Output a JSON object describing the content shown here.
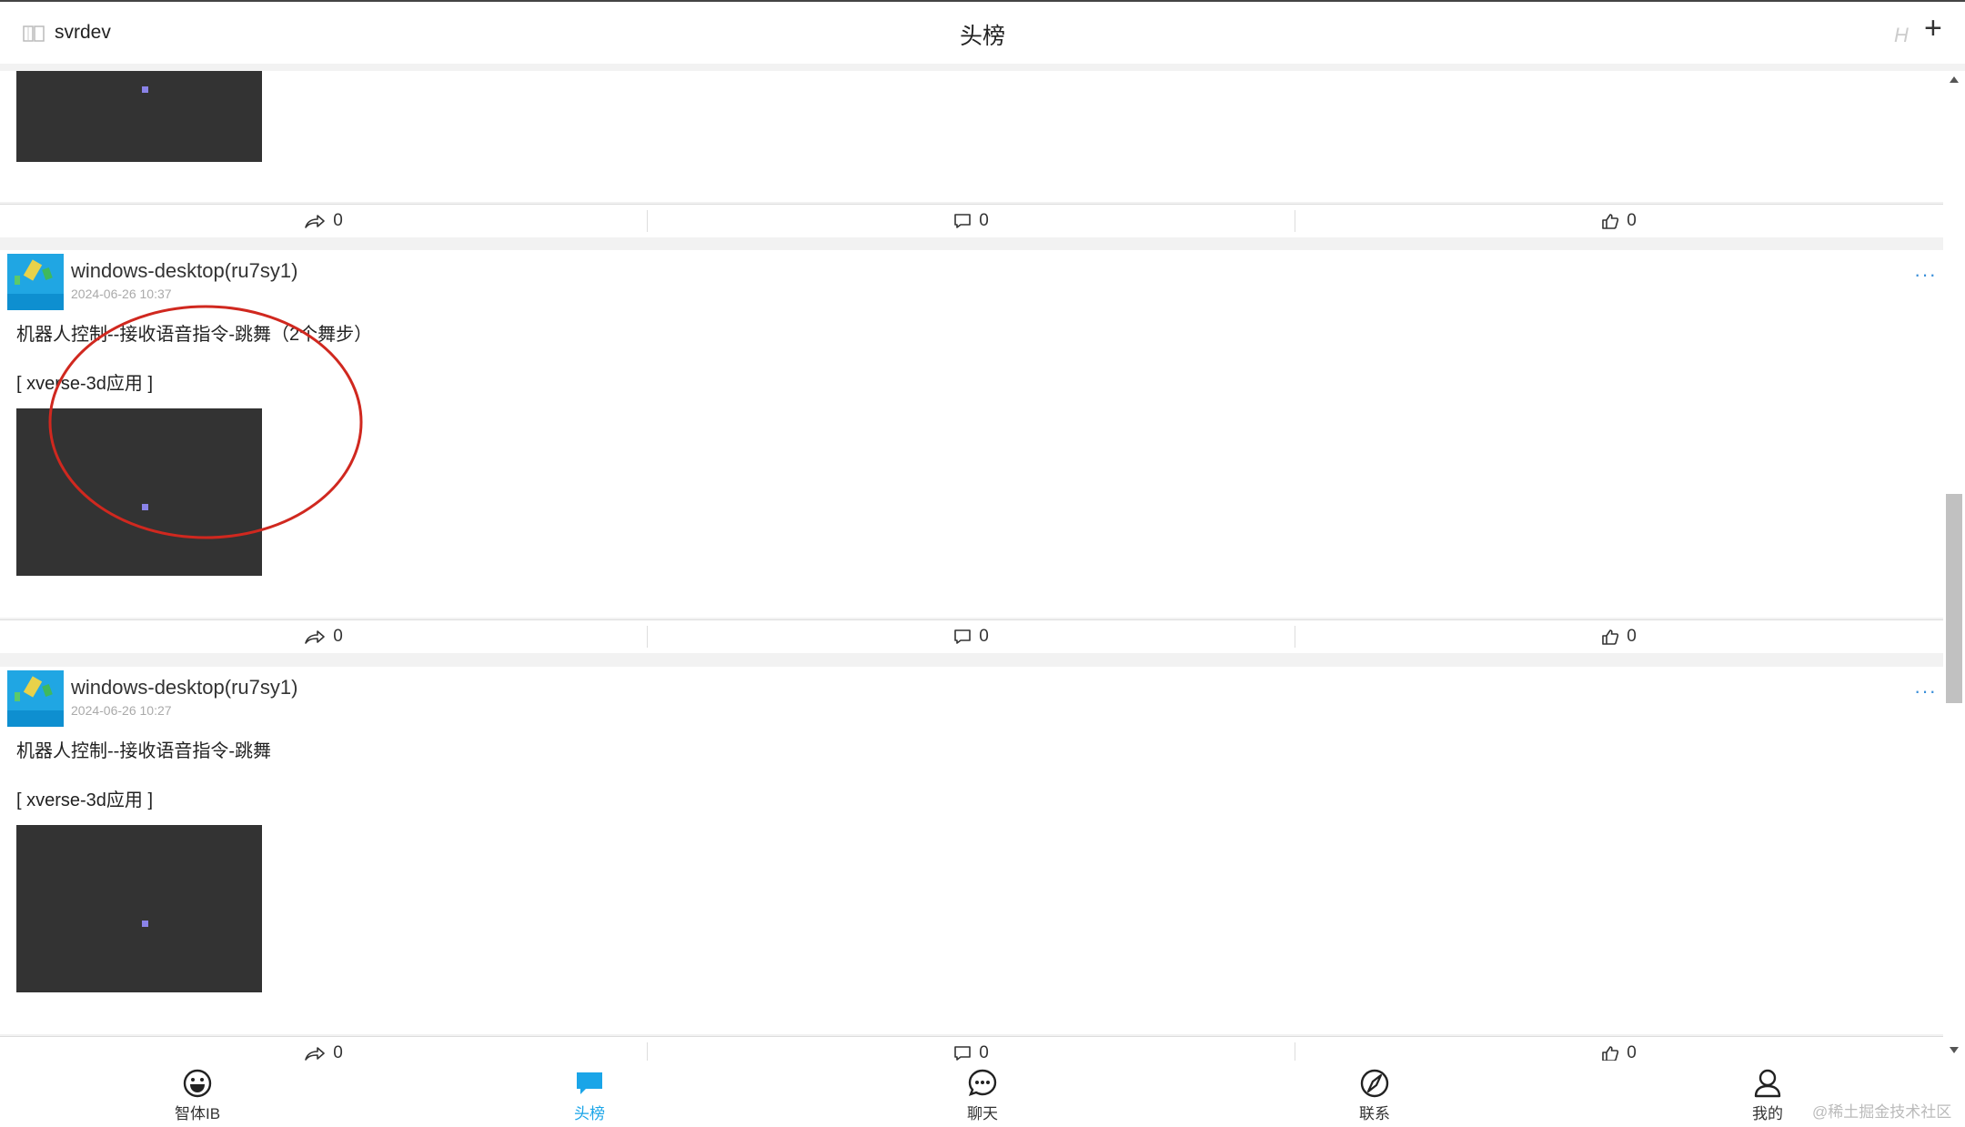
{
  "header": {
    "app_name": "svrdev",
    "title": "头榜",
    "h_label": "H",
    "plus_label": "+"
  },
  "posts": [
    {
      "actions": {
        "share_count": "0",
        "comment_count": "0",
        "like_count": "0"
      }
    },
    {
      "author": "windows-desktop(ru7sy1)",
      "time": "2024-06-26 10:37",
      "text": "机器人控制--接收语音指令-跳舞（2个舞步）",
      "tag": "[ xverse-3d应用 ]",
      "actions": {
        "share_count": "0",
        "comment_count": "0",
        "like_count": "0"
      }
    },
    {
      "author": "windows-desktop(ru7sy1)",
      "time": "2024-06-26 10:27",
      "text": "机器人控制--接收语音指令-跳舞",
      "tag": "[ xverse-3d应用 ]",
      "actions": {
        "share_count": "0",
        "comment_count": "0",
        "like_count": "0"
      }
    }
  ],
  "more_label": "···",
  "nav": {
    "items": [
      {
        "label": "智体IB",
        "icon": "smiley-icon"
      },
      {
        "label": "头榜",
        "icon": "message-square-icon",
        "active": true
      },
      {
        "label": "聊天",
        "icon": "chat-bubble-icon"
      },
      {
        "label": "联系",
        "icon": "compass-icon"
      },
      {
        "label": "我的",
        "icon": "user-icon"
      }
    ]
  },
  "watermark": "@稀土掘金技术社区",
  "colors": {
    "accent": "#1aa5e8",
    "media_bg": "#333333",
    "annotation": "#d0281f"
  }
}
